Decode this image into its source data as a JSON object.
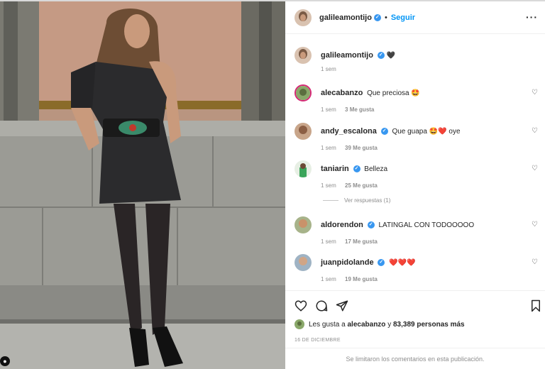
{
  "post": {
    "author": "galileamontijo",
    "follow_label": "Seguir",
    "dot": "•",
    "more_label": "···",
    "caption_emoji": "🖤",
    "caption_time": "1 sem"
  },
  "comments": [
    {
      "user": "alecabanzo",
      "verified": false,
      "text": "Que preciosa 🤩",
      "time": "1 sem",
      "likes": "3 Me gusta"
    },
    {
      "user": "andy_escalona",
      "verified": true,
      "text": "Que guapa 🤩❤️ oye",
      "time": "1 sem",
      "likes": "39 Me gusta"
    },
    {
      "user": "taniarin",
      "verified": true,
      "text": "Belleza",
      "time": "1 sem",
      "likes": "25 Me gusta"
    },
    {
      "user": "aldorendon",
      "verified": true,
      "text": "LATINGAL CON TODOOOOO",
      "time": "1 sem",
      "likes": "17 Me gusta"
    },
    {
      "user": "juanpidolande",
      "verified": true,
      "text": "❤️❤️❤️",
      "time": "1 sem",
      "likes": "19 Me gusta"
    }
  ],
  "replies_label": "Ver respuestas (1)",
  "likes_summary": {
    "prefix": "Les gusta a",
    "user": "alecabanzo",
    "conj": "y",
    "others": "83,389 personas más"
  },
  "date": "16 DE DICIEMBRE",
  "comments_limited": "Se limitaron los comentarios en esta publicación.",
  "icons": [
    "heart-icon",
    "comment-icon",
    "share-icon",
    "bookmark-icon",
    "more-icon",
    "verified-icon"
  ],
  "colors": {
    "accent": "#0095f6",
    "verified": "#3897f0",
    "muted": "#8e8e8e",
    "text": "#262626"
  }
}
